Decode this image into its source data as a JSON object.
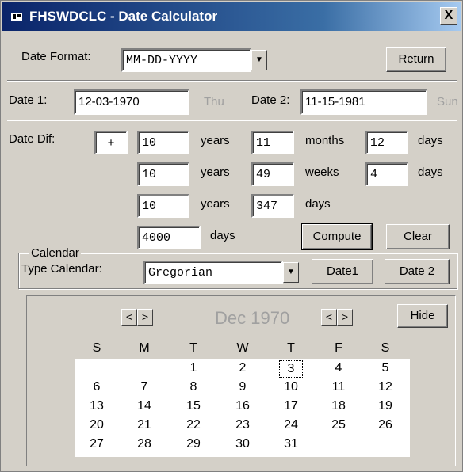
{
  "window": {
    "title": "FHSWDCLC - Date Calculator",
    "close_label": "X"
  },
  "format": {
    "label": "Date Format:",
    "value": "MM-DD-YYYY",
    "return_label": "Return"
  },
  "dates": {
    "date1_label": "Date 1:",
    "date1_value": "12-03-1970",
    "date1_weekday": "Thu",
    "date2_label": "Date 2:",
    "date2_value": "11-15-1981",
    "date2_weekday": "Sun"
  },
  "diff": {
    "label": "Date Dif:",
    "sign": "+",
    "row1": {
      "years": "10",
      "years_unit": "years",
      "months": "11",
      "months_unit": "months",
      "days": "12",
      "days_unit": "days"
    },
    "row2": {
      "years": "10",
      "years_unit": "years",
      "weeks": "49",
      "weeks_unit": "weeks",
      "days": "4",
      "days_unit": "days"
    },
    "row3": {
      "years": "10",
      "years_unit": "years",
      "days": "347",
      "days_unit": "days"
    },
    "row4": {
      "days": "4000",
      "days_unit": "days"
    },
    "compute_label": "Compute",
    "clear_label": "Clear"
  },
  "calendar_group": {
    "label": "Calendar",
    "type_label": "Type Calendar:",
    "type_value": "Gregorian",
    "date1_button": "Date1",
    "date2_button": "Date 2"
  },
  "calendar": {
    "month_year": "Dec 1970",
    "prev": "<",
    "next": ">",
    "hide_label": "Hide",
    "weekdays": [
      "S",
      "M",
      "T",
      "W",
      "T",
      "F",
      "S"
    ],
    "weeks": [
      [
        "",
        "",
        "1",
        "2",
        "3",
        "4",
        "5"
      ],
      [
        "6",
        "7",
        "8",
        "9",
        "10",
        "11",
        "12"
      ],
      [
        "13",
        "14",
        "15",
        "16",
        "17",
        "18",
        "19"
      ],
      [
        "20",
        "21",
        "22",
        "23",
        "24",
        "25",
        "26"
      ],
      [
        "27",
        "28",
        "29",
        "30",
        "31",
        "",
        ""
      ]
    ],
    "selected_day": "3"
  }
}
